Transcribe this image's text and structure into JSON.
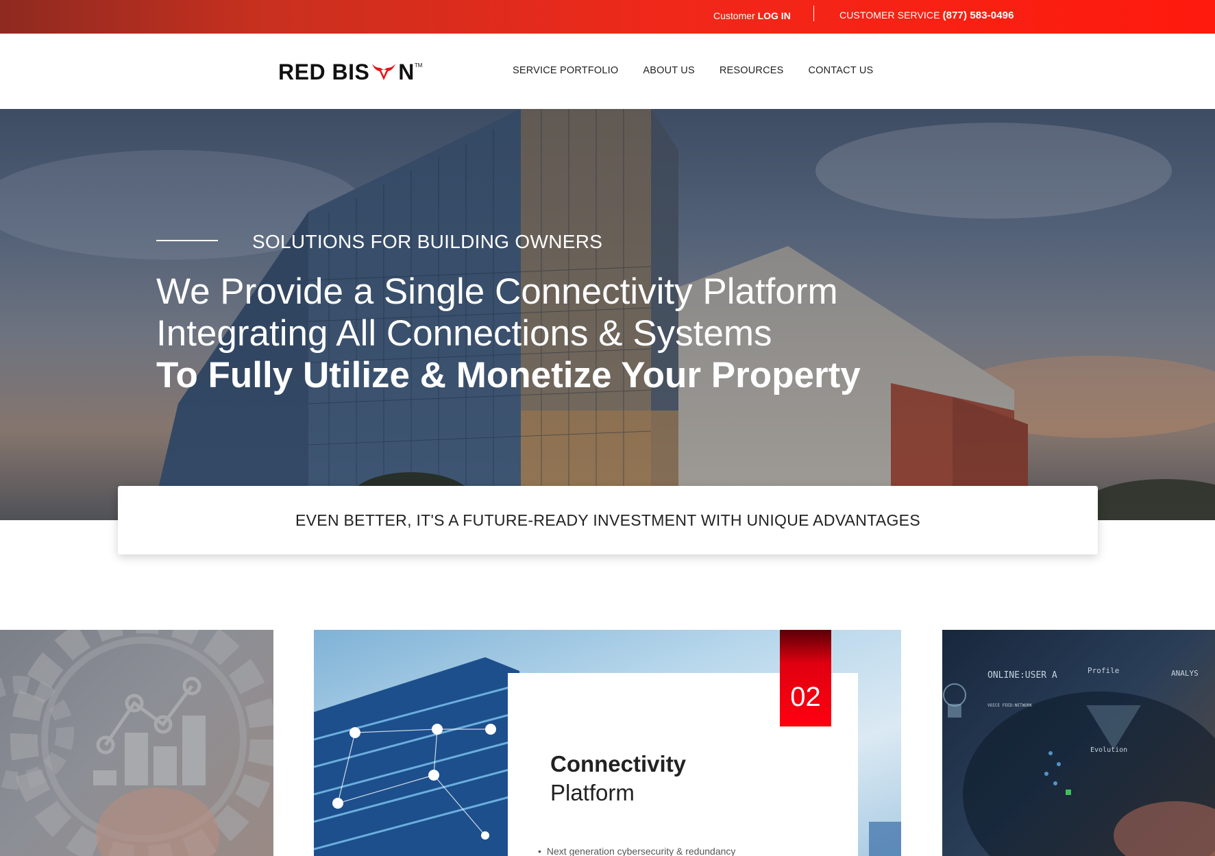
{
  "topbar": {
    "login_prefix": "Customer",
    "login_link": "LOG IN",
    "service_label": "CUSTOMER SERVICE",
    "service_phone": "(877) 583-0496"
  },
  "brand": {
    "left": "RED BIS",
    "right": "N",
    "tm": "TM",
    "accent_color": "#e3161b"
  },
  "nav": {
    "items": [
      "SERVICE PORTFOLIO",
      "ABOUT US",
      "RESOURCES",
      "CONTACT US"
    ]
  },
  "hero": {
    "eyebrow": "SOLUTIONS FOR BUILDING OWNERS",
    "line1": "We Provide a Single Connectivity Platform",
    "line2": "Integrating All Connections & Systems",
    "line3": "To Fully Utilize & Monetize Your Property"
  },
  "callout": {
    "text": "EVEN BETTER, IT'S A FUTURE-READY INVESTMENT WITH UNIQUE ADVANTAGES"
  },
  "features": {
    "card": {
      "number": "02",
      "title_bold": "Connectivity",
      "title_light": "Platform",
      "bullet": "Next generation cybersecurity & redundancy"
    },
    "right_image_text": {
      "online": "ONLINE:USER A",
      "profile": "Profile",
      "analysis": "ANALYS",
      "evolution": "Evolution",
      "voice": "VOICE FEED:NETWORK"
    }
  }
}
